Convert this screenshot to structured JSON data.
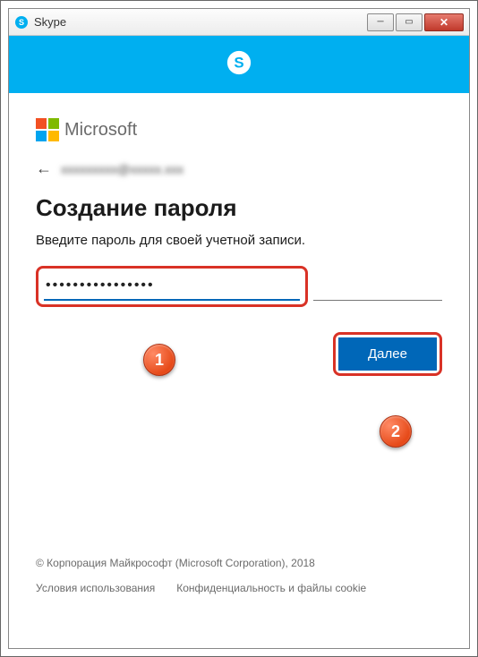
{
  "window": {
    "title": "Skype"
  },
  "brand": {
    "ms_label": "Microsoft"
  },
  "identity": {
    "email": "xxxxxxxxx@xxxxx.xxx"
  },
  "page": {
    "title": "Создание пароля",
    "subtitle": "Введите пароль для своей учетной записи."
  },
  "password": {
    "value": "••••••••••••••••"
  },
  "actions": {
    "next_label": "Далее"
  },
  "callouts": {
    "one": "1",
    "two": "2"
  },
  "footer": {
    "copyright": "© Корпорация Майкрософт (Microsoft Corporation), 2018",
    "terms": "Условия использования",
    "privacy": "Конфиденциальность и файлы cookie"
  }
}
